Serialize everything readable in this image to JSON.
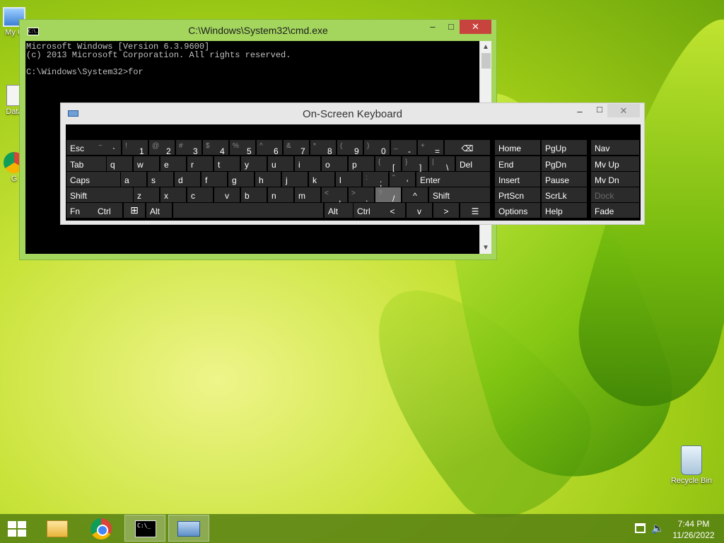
{
  "desktop": {
    "icons": [
      {
        "label": "My C"
      },
      {
        "label": "Data"
      },
      {
        "label": "G"
      },
      {
        "label": "Recycle Bin"
      }
    ]
  },
  "cmd": {
    "title": "C:\\Windows\\System32\\cmd.exe",
    "icon_text": "C:\\.",
    "lines": [
      "Microsoft Windows [Version 6.3.9600]",
      "(c) 2013 Microsoft Corporation. All rights reserved.",
      "",
      "C:\\Windows\\System32>for"
    ]
  },
  "window_buttons": {
    "minimize": "–",
    "maximize": "□",
    "close": "✕"
  },
  "osk": {
    "title": "On-Screen Keyboard",
    "keys": [
      {
        "label": "Esc"
      },
      {
        "shift": "~",
        "char": "`"
      },
      {
        "shift": "!",
        "char": "1"
      },
      {
        "shift": "@",
        "char": "2"
      },
      {
        "shift": "#",
        "char": "3"
      },
      {
        "shift": "$",
        "char": "4"
      },
      {
        "shift": "%",
        "char": "5"
      },
      {
        "shift": "^",
        "char": "6"
      },
      {
        "shift": "&",
        "char": "7"
      },
      {
        "shift": "*",
        "char": "8"
      },
      {
        "shift": "(",
        "char": "9"
      },
      {
        "shift": ")",
        "char": "0"
      },
      {
        "shift": "_",
        "char": "-"
      },
      {
        "shift": "+",
        "char": "="
      },
      {
        "label": "⌫"
      },
      {
        "label": "Home"
      },
      {
        "label": "PgUp"
      },
      {
        "label": "Nav"
      },
      {
        "label": "Tab"
      },
      {
        "label": "q"
      },
      {
        "label": "w"
      },
      {
        "label": "e"
      },
      {
        "label": "r"
      },
      {
        "label": "t"
      },
      {
        "label": "y"
      },
      {
        "label": "u"
      },
      {
        "label": "i"
      },
      {
        "label": "o"
      },
      {
        "label": "p"
      },
      {
        "shift": "{",
        "char": "["
      },
      {
        "shift": "}",
        "char": "]"
      },
      {
        "shift": "|",
        "char": "\\"
      },
      {
        "label": "Del"
      },
      {
        "label": "End"
      },
      {
        "label": "PgDn"
      },
      {
        "label": "Mv Up"
      },
      {
        "label": "Caps"
      },
      {
        "label": "a"
      },
      {
        "label": "s"
      },
      {
        "label": "d"
      },
      {
        "label": "f"
      },
      {
        "label": "g"
      },
      {
        "label": "h"
      },
      {
        "label": "j"
      },
      {
        "label": "k"
      },
      {
        "label": "l"
      },
      {
        "shift": ":",
        "char": ";"
      },
      {
        "shift": "\"",
        "char": "'"
      },
      {
        "label": "Enter"
      },
      {
        "label": "Insert"
      },
      {
        "label": "Pause"
      },
      {
        "label": "Mv Dn"
      },
      {
        "label": "Shift"
      },
      {
        "label": "z"
      },
      {
        "label": "x"
      },
      {
        "label": "c"
      },
      {
        "label": "v"
      },
      {
        "label": "b"
      },
      {
        "label": "n"
      },
      {
        "label": "m"
      },
      {
        "shift": "<",
        "char": ","
      },
      {
        "shift": ">",
        "char": "."
      },
      {
        "shift": "?",
        "char": "/"
      },
      {
        "label": "^"
      },
      {
        "label": "Shift"
      },
      {
        "label": "PrtScn"
      },
      {
        "label": "ScrLk"
      },
      {
        "label": "Dock"
      },
      {
        "label": "Fn"
      },
      {
        "label": "Ctrl"
      },
      {
        "label": "Win"
      },
      {
        "label": "Alt"
      },
      {
        "label": ""
      },
      {
        "label": "Alt"
      },
      {
        "label": "Ctrl"
      },
      {
        "label": "<"
      },
      {
        "label": "v"
      },
      {
        "label": ">"
      },
      {
        "label": "☰"
      },
      {
        "label": "Options"
      },
      {
        "label": "Help"
      },
      {
        "label": "Fade"
      }
    ]
  },
  "taskbar": {
    "time": "7:44 PM",
    "date": "11/26/2022",
    "volume_glyph": "🔈"
  }
}
